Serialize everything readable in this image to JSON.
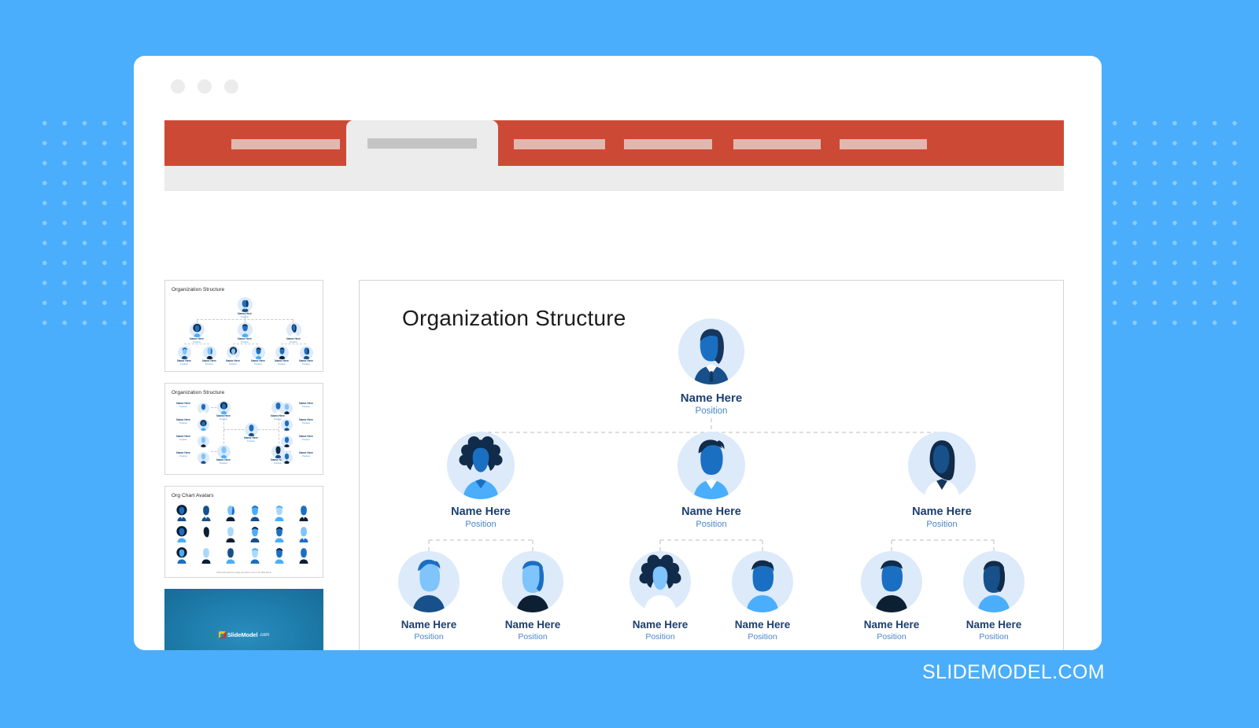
{
  "background": {
    "color": "#4aaefc",
    "dot_color": "#8dcbfd"
  },
  "window": {
    "traffic_lights": [
      "close-dot",
      "minimize-dot",
      "maximize-dot"
    ],
    "ribbon": {
      "bar_color": "#cc4a35",
      "body_color": "#ececec",
      "tabs": [
        {
          "name": "ribbon-tab-1",
          "active": false,
          "label": ""
        },
        {
          "name": "ribbon-tab-2",
          "active": true,
          "label": ""
        },
        {
          "name": "ribbon-tab-3",
          "active": false,
          "label": ""
        },
        {
          "name": "ribbon-tab-4",
          "active": false,
          "label": ""
        },
        {
          "name": "ribbon-tab-5",
          "active": false,
          "label": ""
        },
        {
          "name": "ribbon-tab-6",
          "active": false,
          "label": ""
        }
      ]
    }
  },
  "thumbnails": [
    {
      "title": "Organization Structure",
      "type": "org-chart-vertical"
    },
    {
      "title": "Organization Structure",
      "type": "org-chart-horizontal"
    },
    {
      "title": "Org Chart Avatars",
      "type": "avatar-grid",
      "note": "Click and paste the image you want to use in the slide above"
    },
    {
      "title": "",
      "type": "slidemodel-cover",
      "logo_text": "SlideModel",
      "logo_suffix": ".com"
    }
  ],
  "slide": {
    "title": "Organization Structure",
    "accent_name_color": "#1d3f71",
    "accent_position_color": "#4a86c8",
    "avatar_bg_color": "#dceafa",
    "chart_data": {
      "type": "org-chart",
      "title": "Organization Structure",
      "levels": 3,
      "nodes": [
        {
          "id": "n0",
          "level": 1,
          "name": "Name Here",
          "position": "Position",
          "parent": null,
          "avatar": "woman-long-dark-hair-suit"
        },
        {
          "id": "n1",
          "level": 2,
          "name": "Name Here",
          "position": "Position",
          "parent": "n0",
          "avatar": "woman-afro-light-blue-shirt"
        },
        {
          "id": "n2",
          "level": 2,
          "name": "Name Here",
          "position": "Position",
          "parent": "n0",
          "avatar": "man-short-dark-hair-light-blue-shirt"
        },
        {
          "id": "n3",
          "level": 2,
          "name": "Name Here",
          "position": "Position",
          "parent": "n0",
          "avatar": "woman-dark-bob-white-coat"
        },
        {
          "id": "n4",
          "level": 3,
          "name": "Name Here",
          "position": "Position",
          "parent": "n1",
          "avatar": "man-light-blue-skin-navy-shirt"
        },
        {
          "id": "n5",
          "level": 3,
          "name": "Name Here",
          "position": "Position",
          "parent": "n1",
          "avatar": "woman-blue-bob-black-top"
        },
        {
          "id": "n6",
          "level": 3,
          "name": "Name Here",
          "position": "Position",
          "parent": "n2",
          "avatar": "woman-afro-navy-white-top"
        },
        {
          "id": "n7",
          "level": 3,
          "name": "Name Here",
          "position": "Position",
          "parent": "n2",
          "avatar": "man-dark-hair-light-blue-shirt"
        },
        {
          "id": "n8",
          "level": 3,
          "name": "Name Here",
          "position": "Position",
          "parent": "n3",
          "avatar": "man-navy-shirt-blue-face"
        },
        {
          "id": "n9",
          "level": 3,
          "name": "Name Here",
          "position": "Position",
          "parent": "n3",
          "avatar": "woman-long-hair-light-blue-top"
        }
      ],
      "connector_style": "dashed",
      "connector_color": "#c9c9c9"
    }
  },
  "footer": {
    "brand": "SLIDEMODEL.COM"
  }
}
